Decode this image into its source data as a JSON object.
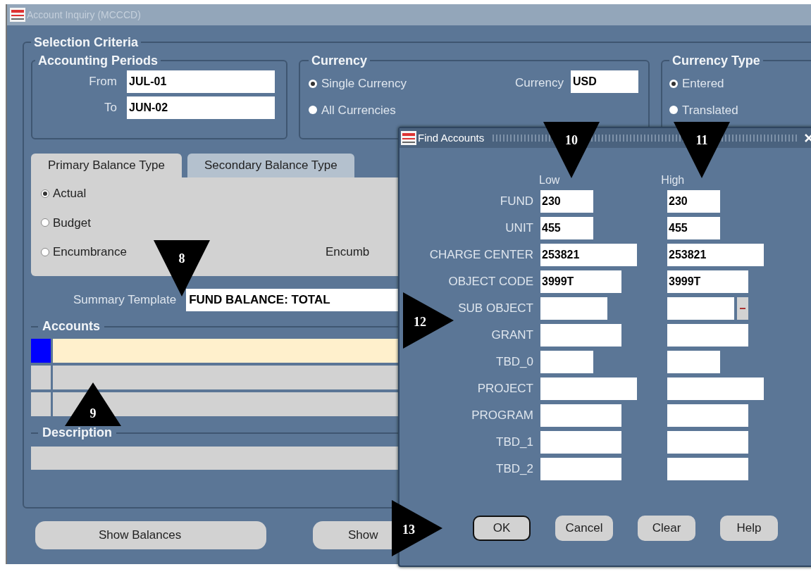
{
  "window": {
    "title": "Account Inquiry (MCCCD)"
  },
  "selection_criteria": {
    "title": "Selection Criteria",
    "accounting_periods": {
      "title": "Accounting Periods",
      "fields": [
        {
          "label": "From",
          "value": "JUL-01"
        },
        {
          "label": "To",
          "value": "JUN-02"
        }
      ]
    },
    "currency": {
      "title": "Currency",
      "options": [
        {
          "label": "Single Currency",
          "selected": true
        },
        {
          "label": "All Currencies",
          "selected": false
        }
      ],
      "currency_label": "Currency",
      "currency_value": "USD"
    },
    "currency_type": {
      "title": "Currency Type",
      "options": [
        {
          "label": "Entered",
          "selected": true
        },
        {
          "label": "Translated",
          "selected": false
        }
      ]
    },
    "tabs": [
      {
        "label": "Primary Balance Type",
        "selected": true
      },
      {
        "label": "Secondary Balance Type",
        "selected": false
      }
    ],
    "balance_types": [
      {
        "label": "Actual",
        "selected": true
      },
      {
        "label": "Budget",
        "selected": false
      },
      {
        "label": "Encumbrance",
        "selected": false
      }
    ],
    "encumbrance_label": "Encumb",
    "summary_template": {
      "label": "Summary Template",
      "value": "FUND BALANCE: TOTAL"
    },
    "accounts": {
      "title": "Accounts",
      "rows": [
        {
          "current": true
        },
        {
          "current": false
        },
        {
          "current": false
        }
      ]
    },
    "description": {
      "title": "Description"
    }
  },
  "buttons": [
    "Show Balances",
    "Show"
  ],
  "find_accounts": {
    "title": "Find Accounts",
    "low_header": "Low",
    "high_header": "High",
    "rows": [
      {
        "label": "FUND",
        "low": "230",
        "high": "230",
        "list_button": false
      },
      {
        "label": "UNIT",
        "low": "455",
        "high": "455",
        "list_button": false
      },
      {
        "label": "CHARGE CENTER",
        "low": "253821",
        "high": "253821",
        "list_button": false
      },
      {
        "label": "OBJECT CODE",
        "low": "3999T",
        "high": "3999T",
        "list_button": false
      },
      {
        "label": "SUB OBJECT",
        "list_button": true
      },
      {
        "label": "GRANT",
        "list_button": false
      },
      {
        "label": "TBD_0",
        "list_button": false
      },
      {
        "label": "PROJECT",
        "list_button": false
      },
      {
        "label": "PROGRAM",
        "list_button": false
      },
      {
        "label": "TBD_1",
        "list_button": false
      },
      {
        "label": "TBD_2",
        "list_button": false
      }
    ],
    "buttons": [
      {
        "label": "OK",
        "default": true
      },
      {
        "label": "Cancel",
        "default": false
      },
      {
        "label": "Clear",
        "default": false
      },
      {
        "label": "Help",
        "default": false
      }
    ]
  },
  "callouts": [
    {
      "label": "8",
      "kind": "down"
    },
    {
      "label": "9",
      "kind": "up"
    },
    {
      "label": "10",
      "kind": "down"
    },
    {
      "label": "11",
      "kind": "down"
    },
    {
      "label": "12",
      "kind": "right"
    },
    {
      "label": "13",
      "kind": "right"
    }
  ]
}
